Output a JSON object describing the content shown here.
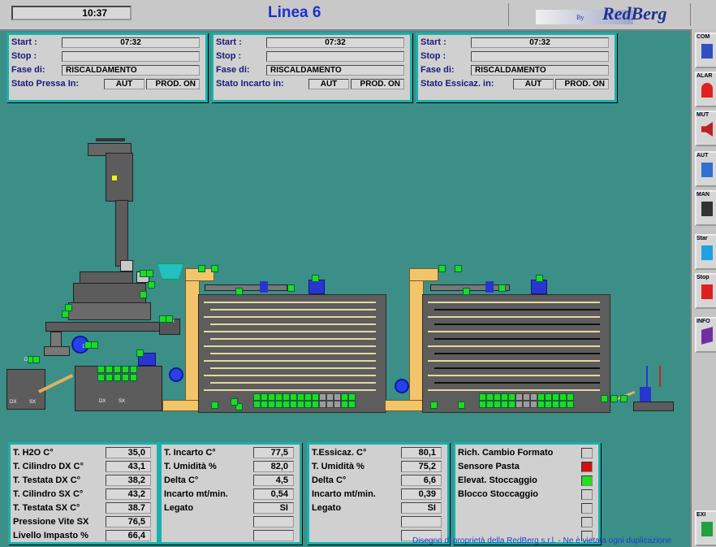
{
  "header": {
    "clock": "10:37",
    "title": "Linea 6",
    "logo_by": "By",
    "logo_text": "RedBerg"
  },
  "panels": [
    {
      "start_label": "Start :",
      "start_value": "07:32",
      "stop_label": "Stop :",
      "stop_value": "",
      "phase_label": "Fase di:",
      "phase_value": "RISCALDAMENTO",
      "state_label": "Stato Pressa In:",
      "mode": "AUT",
      "prod": "PROD. ON"
    },
    {
      "start_label": "Start :",
      "start_value": "07:32",
      "stop_label": "Stop :",
      "stop_value": "",
      "phase_label": "Fase di:",
      "phase_value": "RISCALDAMENTO",
      "state_label": "Stato Incarto in:",
      "mode": "AUT",
      "prod": "PROD. ON"
    },
    {
      "start_label": "Start :",
      "start_value": "07:32",
      "stop_label": "Stop :",
      "stop_value": "",
      "phase_label": "Fase di:",
      "phase_value": "RISCALDAMENTO",
      "state_label": "Stato Essicaz. in:",
      "mode": "AUT",
      "prod": "PROD. ON"
    }
  ],
  "toolbar": [
    {
      "label": "COM",
      "icon": "computer-icon"
    },
    {
      "label": "ALAR",
      "icon": "alarm-light-icon"
    },
    {
      "label": "MUT",
      "icon": "speaker-icon"
    },
    {
      "label": "AUT",
      "icon": "auto-icon"
    },
    {
      "label": "MAN",
      "icon": "hand-icon"
    },
    {
      "label": "Star",
      "icon": "start-check-icon"
    },
    {
      "label": "Stop",
      "icon": "stop-x-icon"
    },
    {
      "label": "INFO",
      "icon": "book-icon"
    },
    {
      "label": "EXI",
      "icon": "exit-icon"
    }
  ],
  "machine": {
    "press_labels": [
      "DX",
      "SX"
    ],
    "labels_small": [
      "DX",
      "SX",
      "DX SX",
      "DXSX",
      "DX",
      "SX"
    ]
  },
  "table1": [
    {
      "k": "T. H2O C°",
      "v": "35,0"
    },
    {
      "k": "T. Cilindro DX C°",
      "v": "43,1"
    },
    {
      "k": "T. Testata DX C°",
      "v": "38,2"
    },
    {
      "k": "T. Cilindro SX C°",
      "v": "43,2"
    },
    {
      "k": "T. Testata SX C°",
      "v": "38.7"
    },
    {
      "k": "Pressione Vite SX",
      "v": "76,5"
    },
    {
      "k": "Livello Impasto %",
      "v": "66,4"
    }
  ],
  "table2": [
    {
      "k": "T. Incarto C°",
      "v": "77,5"
    },
    {
      "k": "T. Umidità %",
      "v": "82,0"
    },
    {
      "k": "Delta C°",
      "v": "4,5"
    },
    {
      "k": "Incarto mt/min.",
      "v": "0,54"
    },
    {
      "k": "Legato",
      "v": "SI"
    },
    {
      "k": "",
      "v": ""
    },
    {
      "k": "",
      "v": ""
    }
  ],
  "table3": [
    {
      "k": "T.Essicaz. C°",
      "v": "80,1"
    },
    {
      "k": "T. Umidità %",
      "v": "75,2"
    },
    {
      "k": "Delta C°",
      "v": "6,6"
    },
    {
      "k": "Incarto mt/min.",
      "v": "0,39"
    },
    {
      "k": "Legato",
      "v": "SI"
    },
    {
      "k": "",
      "v": ""
    },
    {
      "k": "",
      "v": ""
    }
  ],
  "table4": [
    {
      "k": "Rich. Cambio Formato",
      "color": "#d0d0d0"
    },
    {
      "k": "Sensore Pasta",
      "color": "#d01010"
    },
    {
      "k": "Elevat. Stoccaggio",
      "color": "#20e020"
    },
    {
      "k": "Blocco Stoccaggio",
      "color": "#d0d0d0"
    },
    {
      "k": "",
      "color": "#d0d0d0"
    },
    {
      "k": "",
      "color": "#d0d0d0"
    },
    {
      "k": "",
      "color": "#d0d0d0"
    }
  ],
  "footer": "Disegno di proprietà della RedBerg s.r.l. - Ne è vietata ogni duplicazione"
}
